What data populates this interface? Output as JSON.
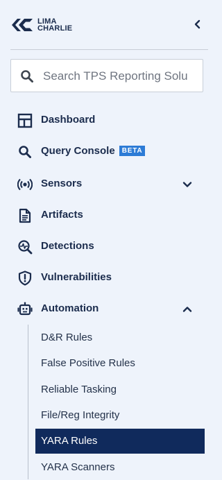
{
  "brand": {
    "line1": "LIMA",
    "line2": "CHARLIE",
    "logo_icon": "limacharlie-logo-icon"
  },
  "collapse_icon": "chevron-left-icon",
  "search": {
    "placeholder": "Search TPS Reporting Solu",
    "value": ""
  },
  "nav": [
    {
      "label": "Dashboard",
      "icon": "dashboard-icon"
    },
    {
      "label": "Query Console",
      "badge": "BETA",
      "icon": "search-icon"
    },
    {
      "label": "Sensors",
      "icon": "sensors-icon",
      "expandable": true,
      "expanded": false
    },
    {
      "label": "Artifacts",
      "icon": "document-icon"
    },
    {
      "label": "Detections",
      "icon": "detections-icon"
    },
    {
      "label": "Vulnerabilities",
      "icon": "shield-alert-icon"
    },
    {
      "label": "Automation",
      "icon": "robot-icon",
      "expandable": true,
      "expanded": true
    }
  ],
  "automation_items": [
    {
      "label": "D&R Rules"
    },
    {
      "label": "False Positive Rules"
    },
    {
      "label": "Reliable Tasking"
    },
    {
      "label": "File/Reg Integrity"
    },
    {
      "label": "YARA Rules",
      "active": true
    },
    {
      "label": "YARA Scanners"
    }
  ],
  "colors": {
    "background": "#eef3fb",
    "text": "#1b2c4d",
    "active_bg": "#102a5c",
    "badge_bg": "#2c7bd6"
  }
}
